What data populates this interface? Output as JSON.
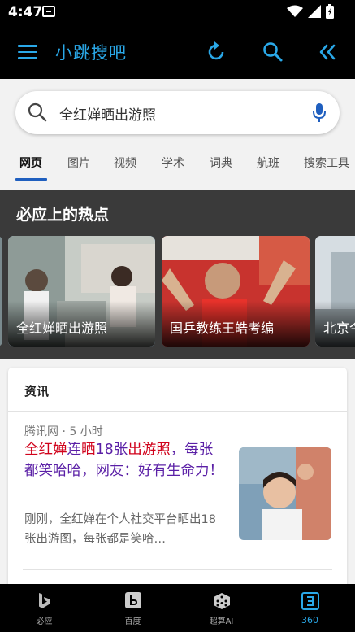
{
  "status_bar": {
    "time": "4:47"
  },
  "app_bar": {
    "title": "小跳搜吧"
  },
  "search": {
    "query": "全红婵晒出游照"
  },
  "tabs": [
    "网页",
    "图片",
    "视频",
    "学术",
    "词典",
    "航班",
    "搜索工具"
  ],
  "hot": {
    "title": "必应上的热点",
    "cards": [
      {
        "label": "全红婵晒出游照"
      },
      {
        "label": "国乒教练王皓考编"
      },
      {
        "label": "北京今"
      }
    ]
  },
  "news": {
    "header": "资讯",
    "item": {
      "source_time": "腾讯网 · 5 小时",
      "title_parts": [
        "全红婵",
        "连",
        "晒",
        "18张",
        "出游照",
        "，每张都笑哈哈，网友：好有生命力！"
      ],
      "snippet": "刚刚，全红婵在个人社交平台晒出18张出游图，每张都是笑哈…"
    }
  },
  "bottom_nav": [
    {
      "label": "必应",
      "icon": "bing-icon"
    },
    {
      "label": "百度",
      "icon": "baidu-icon"
    },
    {
      "label": "超算AI",
      "icon": "dice-icon"
    },
    {
      "label": "360",
      "icon": "360-icon"
    }
  ],
  "colors": {
    "accent": "#2aa8e8",
    "title_purple": "#5a1fa6",
    "highlight_red": "#d0021b",
    "tab_underline": "#1f5fbf"
  }
}
